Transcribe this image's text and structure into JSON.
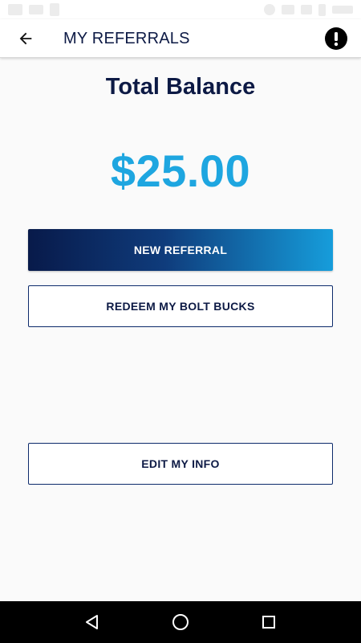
{
  "header": {
    "title": "MY REFERRALS",
    "back_icon": "arrow-left-icon",
    "alert_icon": "exclamation-circle-icon"
  },
  "balance": {
    "label": "Total Balance",
    "amount": "$25.00"
  },
  "actions": {
    "new_referral": "NEW REFERRAL",
    "redeem": "REDEEM MY BOLT BUCKS",
    "edit_info": "EDIT MY INFO"
  },
  "navigation": {
    "back": "triangle-back-icon",
    "home": "circle-home-icon",
    "recents": "square-recents-icon"
  },
  "colors": {
    "brand_navy": "#0d1a45",
    "accent_blue": "#1ea6e0",
    "gradient_start": "#081a4a",
    "gradient_end": "#169ddb"
  }
}
